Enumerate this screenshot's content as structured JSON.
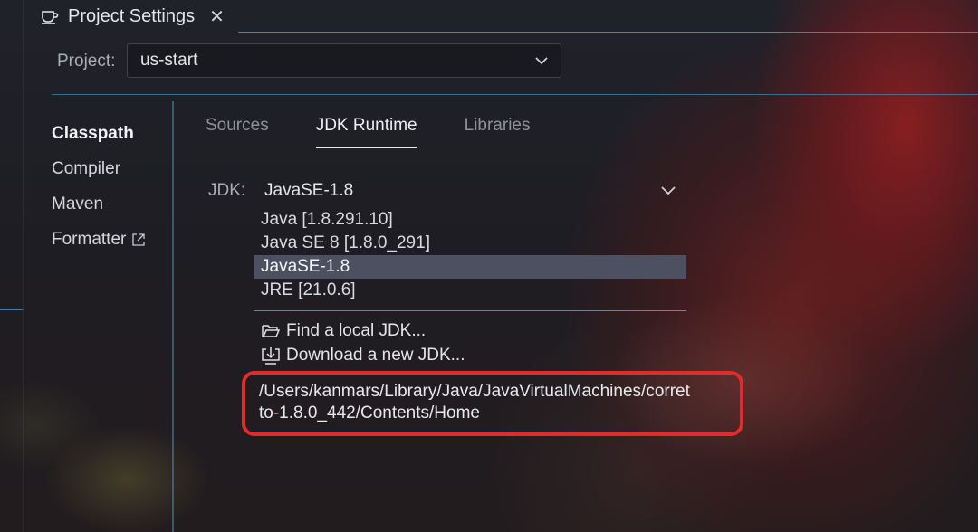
{
  "colors": {
    "accent": "#3c8fc0",
    "highlight": "#e02d2b",
    "selected_bg": "#4d5061"
  },
  "tab": {
    "icon": "coffee-cup-icon",
    "title": "Project Settings",
    "close": "✕"
  },
  "project": {
    "label": "Project:",
    "value": "us-start"
  },
  "sidebar": {
    "items": [
      {
        "label": "Classpath",
        "active": true
      },
      {
        "label": "Compiler"
      },
      {
        "label": "Maven"
      },
      {
        "label": "Formatter",
        "icon": "external-link-icon"
      }
    ]
  },
  "content_tabs": [
    {
      "label": "Sources"
    },
    {
      "label": "JDK Runtime",
      "active": true
    },
    {
      "label": "Libraries"
    }
  ],
  "jdk": {
    "label": "JDK:",
    "value": "JavaSE-1.8",
    "options": [
      "Java [1.8.291.10]",
      "Java SE 8 [1.8.0_291]",
      "JavaSE-1.8",
      "JRE [21.0.6]"
    ],
    "selected_index": 2,
    "actions": [
      {
        "icon": "folder-open-icon",
        "label": "Find a local JDK..."
      },
      {
        "icon": "download-icon",
        "label": "Download a new JDK..."
      }
    ],
    "path": "/Users/kanmars/Library/Java/JavaVirtualMachines/corretto-1.8.0_442/Contents/Home"
  }
}
